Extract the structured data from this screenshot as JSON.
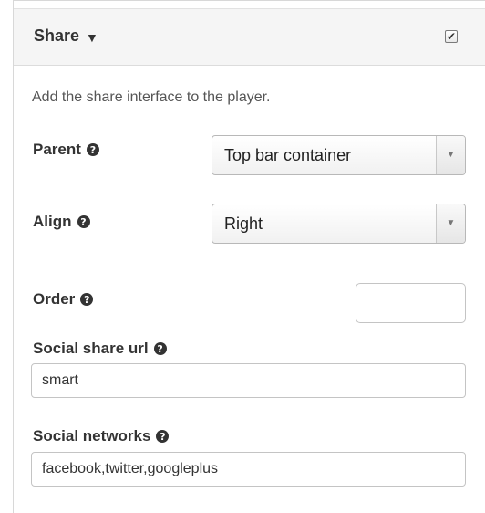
{
  "section": {
    "title": "Share",
    "caret_icon": "caret-down-icon",
    "enabled_checkbox": {
      "checked": true,
      "icon": "check-icon"
    },
    "description": "Add the share interface to the player."
  },
  "fields": {
    "parent": {
      "label": "Parent",
      "help_icon": "question-circle-icon",
      "value": "Top bar container"
    },
    "align": {
      "label": "Align",
      "help_icon": "question-circle-icon",
      "value": "Right"
    },
    "order": {
      "label": "Order",
      "help_icon": "question-circle-icon",
      "value": ""
    },
    "social_share_url": {
      "label": "Social share url",
      "help_icon": "question-circle-icon",
      "value": "smart"
    },
    "social_networks": {
      "label": "Social networks",
      "help_icon": "question-circle-icon",
      "value": "facebook,twitter,googleplus"
    }
  },
  "glyphs": {
    "caret": "▼",
    "check": "✔",
    "help": "?",
    "select_arrow": "▼"
  }
}
